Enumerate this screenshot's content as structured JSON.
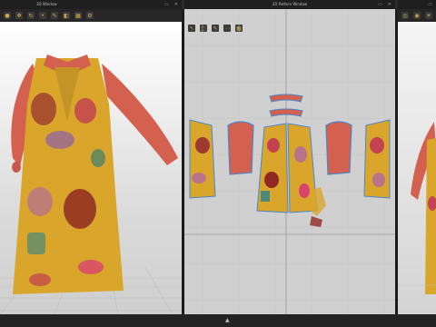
{
  "windows": {
    "left_title": "3D Window",
    "center_title": "2D Pattern Window"
  },
  "icons": {
    "left_toolbar": [
      "avatar-icon",
      "move-icon",
      "rotate-icon",
      "pin-icon",
      "brush-icon",
      "fold-icon",
      "cloth-icon",
      "settings-icon"
    ],
    "center_toolbar": [
      "select-icon",
      "transform-icon",
      "pen-icon",
      "sewing-icon",
      "layout-icon"
    ],
    "bottom": "chevron-up-icon"
  },
  "colors": {
    "fabric_base": "#d9a62b",
    "sleeve": "#d4604f",
    "pattern_outline": "#4a86c8",
    "bg_3d": "#f2f2f2",
    "bg_2d": "#d0d0d0"
  }
}
